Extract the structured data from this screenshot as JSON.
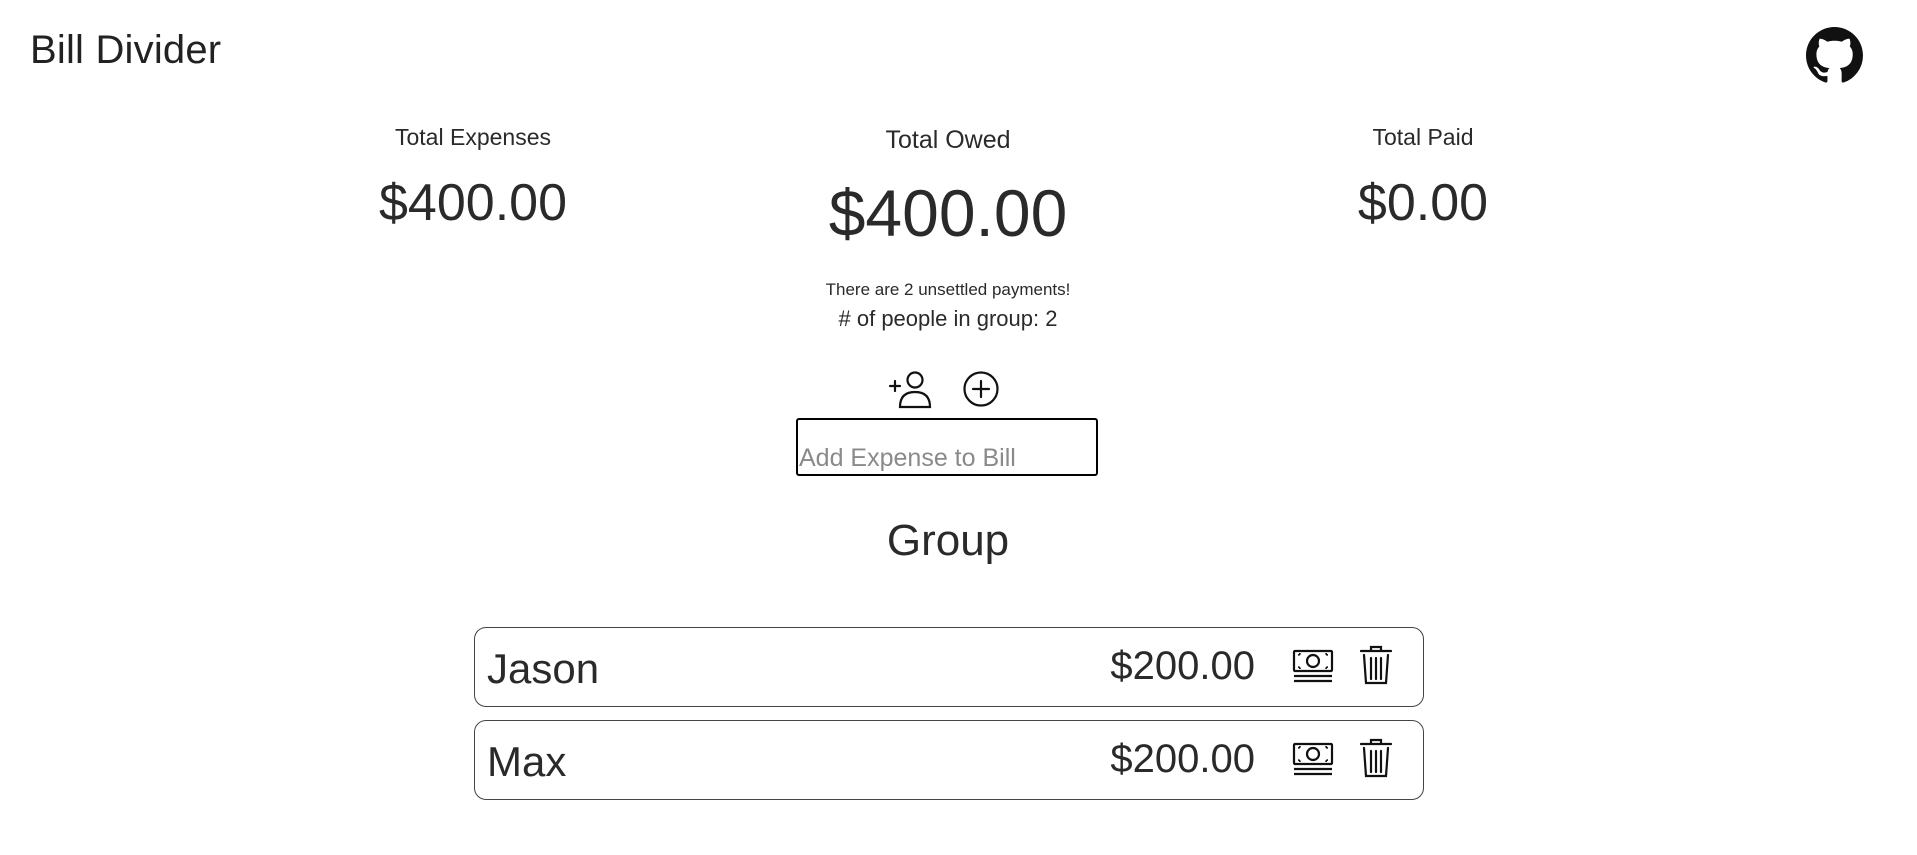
{
  "header": {
    "title": "Bill Divider",
    "github_icon": "github-icon"
  },
  "summary": {
    "total_expenses_label": "Total Expenses",
    "total_expenses_value": "$400.00",
    "total_owed_label": "Total Owed",
    "total_owed_value": "$400.00",
    "total_paid_label": "Total Paid",
    "total_paid_value": "$0.00",
    "unsettled_text": "There are 2 unsettled payments!",
    "people_count_text": "# of people in group: 2"
  },
  "actions": {
    "add_person_icon": "add-person-icon",
    "add_expense_icon": "plus-circle-icon"
  },
  "expense_input": {
    "value": "",
    "placeholder": "Add Expense to Bill"
  },
  "group": {
    "title": "Group",
    "members": [
      {
        "name": "Jason",
        "amount": "$200.00",
        "pay_icon": "money-icon",
        "delete_icon": "trash-icon"
      },
      {
        "name": "Max",
        "amount": "$200.00",
        "pay_icon": "money-icon",
        "delete_icon": "trash-icon"
      }
    ]
  },
  "colors": {
    "text": "#2a2a2a",
    "border": "#444444",
    "background": "#ffffff"
  }
}
